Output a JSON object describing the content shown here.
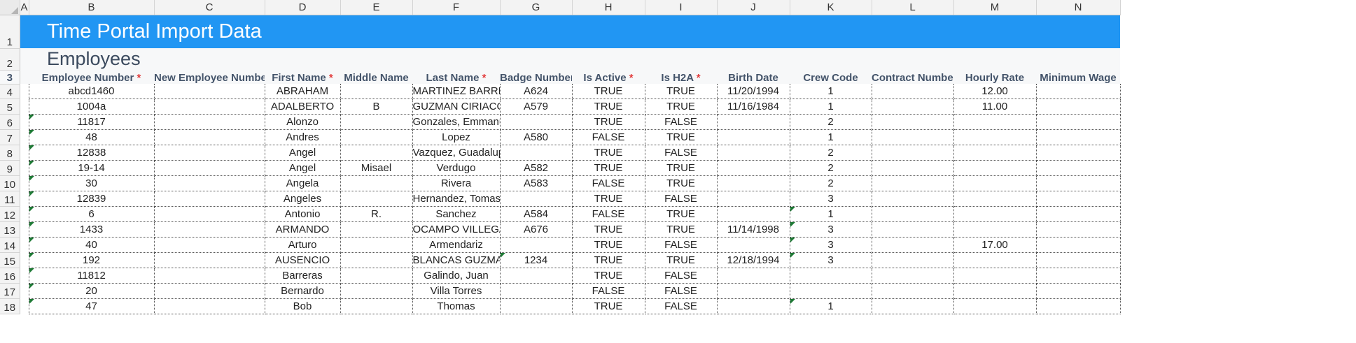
{
  "columns": [
    "A",
    "B",
    "C",
    "D",
    "E",
    "F",
    "G",
    "H",
    "I",
    "J",
    "K",
    "L",
    "M",
    "N"
  ],
  "banner": {
    "row_num": "1",
    "title": "Time Portal Import Data"
  },
  "section": {
    "row_num": "2",
    "title": "Employees"
  },
  "header_row_num": "3",
  "headers": [
    {
      "label": "Employee Number",
      "required": true
    },
    {
      "label": "New Employee Number",
      "required": false
    },
    {
      "label": "First Name",
      "required": true
    },
    {
      "label": "Middle Name",
      "required": false
    },
    {
      "label": "Last Name",
      "required": true
    },
    {
      "label": "Badge Number",
      "required": false
    },
    {
      "label": "Is Active",
      "required": true
    },
    {
      "label": "Is H2A",
      "required": true
    },
    {
      "label": "Birth Date",
      "required": false
    },
    {
      "label": "Crew Code",
      "required": false
    },
    {
      "label": "Contract Number",
      "required": false
    },
    {
      "label": "Hourly Rate",
      "required": false
    },
    {
      "label": "Minimum Wage",
      "required": false
    }
  ],
  "required_marker": "*",
  "rows": [
    {
      "n": "4",
      "cells": [
        "abcd1460",
        "",
        "ABRAHAM",
        "",
        "MARTINEZ BARRERA",
        "A624",
        "TRUE",
        "TRUE",
        "11/20/1994",
        "1",
        "",
        "12.00",
        ""
      ]
    },
    {
      "n": "5",
      "cells": [
        "1004a",
        "",
        "ADALBERTO",
        "B",
        "GUZMAN CIRIACO",
        "A579",
        "TRUE",
        "TRUE",
        "11/16/1984",
        "1",
        "",
        "11.00",
        ""
      ]
    },
    {
      "n": "6",
      "cells": [
        "11817",
        "",
        "Alonzo",
        "",
        "Gonzales, Emmanuel",
        "",
        "TRUE",
        "FALSE",
        "",
        "2",
        "",
        "",
        ""
      ]
    },
    {
      "n": "7",
      "cells": [
        "48",
        "",
        "Andres",
        "",
        "Lopez",
        "A580",
        "FALSE",
        "TRUE",
        "",
        "1",
        "",
        "",
        ""
      ]
    },
    {
      "n": "8",
      "cells": [
        "12838",
        "",
        "Angel",
        "",
        "Vazquez, Guadalupe",
        "",
        "TRUE",
        "FALSE",
        "",
        "2",
        "",
        "",
        ""
      ]
    },
    {
      "n": "9",
      "cells": [
        "19-14",
        "",
        "Angel",
        "Misael",
        "Verdugo",
        "A582",
        "TRUE",
        "TRUE",
        "",
        "2",
        "",
        "",
        ""
      ]
    },
    {
      "n": "10",
      "cells": [
        "30",
        "",
        "Angela",
        "",
        "Rivera",
        "A583",
        "FALSE",
        "TRUE",
        "",
        "2",
        "",
        "",
        ""
      ]
    },
    {
      "n": "11",
      "cells": [
        "12839",
        "",
        "Angeles",
        "",
        "Hernandez, Tomas",
        "",
        "TRUE",
        "FALSE",
        "",
        "3",
        "",
        "",
        ""
      ]
    },
    {
      "n": "12",
      "cells": [
        "6",
        "",
        "Antonio",
        "R.",
        "Sanchez",
        "A584",
        "FALSE",
        "TRUE",
        "",
        "1",
        "",
        "",
        ""
      ]
    },
    {
      "n": "13",
      "cells": [
        "1433",
        "",
        "ARMANDO",
        "",
        "OCAMPO VILLEGAS",
        "A676",
        "TRUE",
        "TRUE",
        "11/14/1998",
        "3",
        "",
        "",
        ""
      ]
    },
    {
      "n": "14",
      "cells": [
        "40",
        "",
        "Arturo",
        "",
        "Armendariz",
        "",
        "TRUE",
        "FALSE",
        "",
        "3",
        "",
        "17.00",
        ""
      ]
    },
    {
      "n": "15",
      "cells": [
        "192",
        "",
        "AUSENCIO",
        "",
        "BLANCAS GUZMAN",
        "1234",
        "TRUE",
        "TRUE",
        "12/18/1994",
        "3",
        "",
        "",
        ""
      ]
    },
    {
      "n": "16",
      "cells": [
        "11812",
        "",
        "Barreras",
        "",
        "Galindo, Juan",
        "",
        "TRUE",
        "FALSE",
        "",
        "",
        "",
        "",
        ""
      ]
    },
    {
      "n": "17",
      "cells": [
        "20",
        "",
        "Bernardo",
        "",
        "Villa Torres",
        "",
        "FALSE",
        "FALSE",
        "",
        "",
        "",
        "",
        ""
      ]
    },
    {
      "n": "18",
      "cells": [
        "47",
        "",
        "Bob",
        "",
        "Thomas",
        "",
        "TRUE",
        "FALSE",
        "",
        "1",
        "",
        "",
        ""
      ]
    }
  ],
  "colors": {
    "banner": "#2196f3",
    "required": "#e23b3b",
    "header_text": "#44546a"
  }
}
